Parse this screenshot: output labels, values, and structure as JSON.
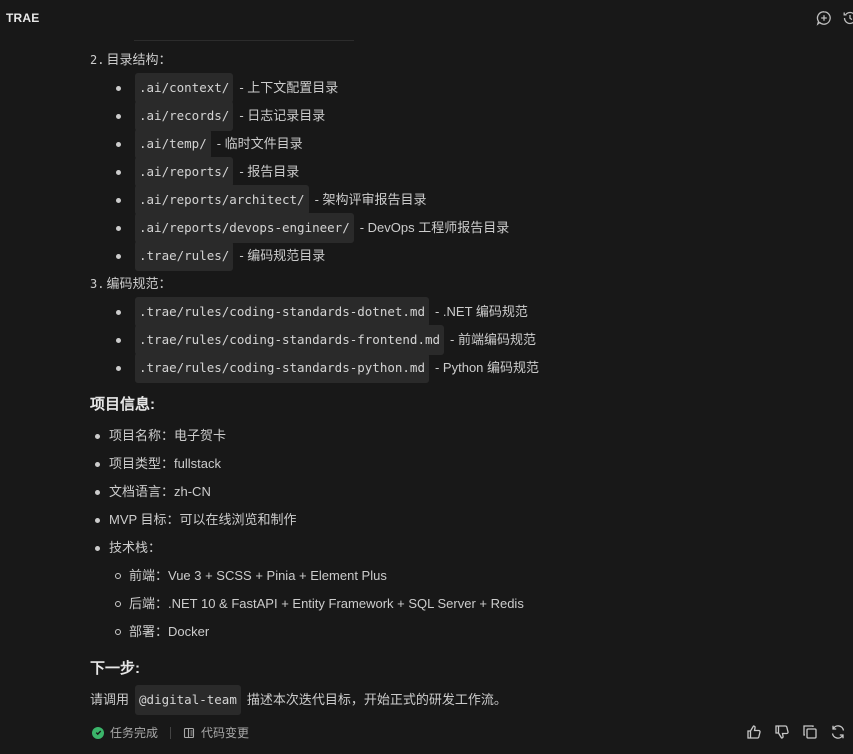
{
  "app": {
    "title": "TRAE"
  },
  "header_icons": [
    "chat-plus-icon",
    "history-icon"
  ],
  "sections": {
    "dir_heading": {
      "num": "2.",
      "label": "目录结构："
    },
    "dirs": [
      {
        "code": ".ai/context/",
        "desc": "- 上下文配置目录"
      },
      {
        "code": ".ai/records/",
        "desc": "- 日志记录目录"
      },
      {
        "code": ".ai/temp/",
        "desc": "- 临时文件目录"
      },
      {
        "code": ".ai/reports/",
        "desc": "- 报告目录"
      },
      {
        "code": ".ai/reports/architect/",
        "desc": "- 架构评审报告目录"
      },
      {
        "code": ".ai/reports/devops-engineer/",
        "desc": "- DevOps 工程师报告目录"
      },
      {
        "code": ".trae/rules/",
        "desc": "- 编码规范目录"
      }
    ],
    "code_heading": {
      "num": "3.",
      "label": "编码规范："
    },
    "codes": [
      {
        "code": ".trae/rules/coding-standards-dotnet.md",
        "desc": "- .NET 编码规范"
      },
      {
        "code": ".trae/rules/coding-standards-frontend.md",
        "desc": "- 前端编码规范"
      },
      {
        "code": ".trae/rules/coding-standards-python.md",
        "desc": "- Python 编码规范"
      }
    ],
    "project_title": "项目信息:",
    "project_items": [
      "项目名称：电子贺卡",
      "项目类型：fullstack",
      "文档语言：zh-CN",
      "MVP 目标：可以在线浏览和制作",
      "技术栈："
    ],
    "tech_items": [
      "前端：Vue 3 + SCSS + Pinia + Element Plus",
      "后端：.NET 10 & FastAPI + Entity Framework + SQL Server + Redis",
      "部署：Docker"
    ],
    "next_title": "下一步:",
    "next_para": {
      "before": "请调用",
      "mention": "@digital-team",
      "after": "描述本次迭代目标，开始正式的研发工作流。"
    }
  },
  "footer": {
    "status_label": "任务完成",
    "changes_label": "代码变更",
    "status_color": "#3bb56a"
  }
}
